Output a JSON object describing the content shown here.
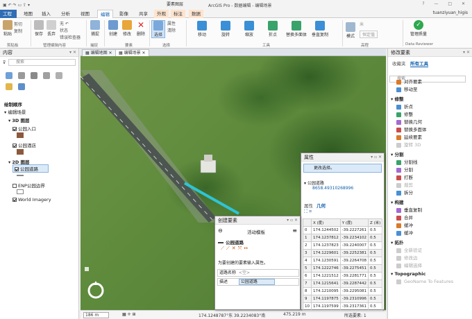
{
  "titlebar": {
    "context_label": "要素图层",
    "title": "ArcGIS Pro - 数据编辑 - 编辑场景",
    "window_controls": "? — □ ✕",
    "user": "tuanziyuan_higis"
  },
  "tabs": [
    "工程",
    "地图",
    "插入",
    "分析",
    "视图",
    "编辑",
    "影像",
    "共享",
    "外观",
    "标注",
    "数据"
  ],
  "ribbon": {
    "clipboard": {
      "paste": "粘贴",
      "cut": "剪切",
      "copy": "复制",
      "group": "剪贴板"
    },
    "manage": {
      "save": "保存",
      "discard": "丢弃",
      "undo": "无 ↶",
      "status": "状态",
      "error_inspector": "错误检查器",
      "group": "管理编辑内容"
    },
    "snapping": {
      "label": "捕捉",
      "group": "捕捉"
    },
    "features": {
      "create": "创建",
      "modify": "修改",
      "delete": "删除",
      "group": "要素"
    },
    "selection": {
      "select": "选择",
      "attributes": "属性",
      "clear": "清除",
      "group": "选择"
    },
    "tools": {
      "items": [
        "移动",
        "旋转",
        "缩放",
        "折点",
        "替换多面体",
        "垂直复制"
      ],
      "group": "工具"
    },
    "elevation": {
      "mode": "模式",
      "value": "恒定值",
      "unit": "米",
      "group": "高程"
    },
    "reviewer": {
      "button": "管理质量",
      "group": "Data Reviewer"
    }
  },
  "view_tabs": [
    "编辑地图",
    "编辑场景"
  ],
  "contents": {
    "title": "内容",
    "search_placeholder": "搜索",
    "drawing_order": "绘制顺序",
    "scene": "编辑场景",
    "layer3d": "3D 图层",
    "park_entrance": "公园入口",
    "park_bldg": "公园酒店",
    "layer2d": "2D 图层",
    "park_road": "公园道路",
    "enp_boundary": "ENP公园边界",
    "imagery": "World Imagery"
  },
  "map": {
    "scale": "186 m",
    "coords": "174.1248787°东 39.2234083°南",
    "elevation": "475.219 m",
    "selected": "所选要素: 1"
  },
  "modify": {
    "title": "修改要素",
    "tab_favorites": "收藏夹",
    "tab_all": "所有工具",
    "search_placeholder": "搜索",
    "sections": [
      {
        "name": "",
        "items": [
          [
            "对齐要素",
            false
          ],
          [
            "移动至",
            false
          ]
        ]
      },
      {
        "name": "修整",
        "items": [
          [
            "折点",
            false
          ],
          [
            "修整",
            false
          ],
          [
            "替换几何",
            false
          ],
          [
            "替换多面体",
            false
          ],
          [
            "延续要素",
            false
          ],
          [
            "旋转 3D",
            true
          ]
        ]
      },
      {
        "name": "分割",
        "items": [
          [
            "分割线",
            false
          ],
          [
            "分割",
            false
          ],
          [
            "打断",
            false
          ],
          [
            "裁剪",
            true
          ],
          [
            "拆分",
            false
          ]
        ]
      },
      {
        "name": "构建",
        "items": [
          [
            "垂直复制",
            false
          ],
          [
            "合并",
            false
          ],
          [
            "缓冲",
            false
          ],
          [
            "缓冲",
            false
          ]
        ]
      },
      {
        "name": "拓扑",
        "items": [
          [
            "全新验证",
            true
          ],
          [
            "修改边",
            true
          ],
          [
            "编辑选择",
            true
          ]
        ]
      },
      {
        "name": "Topographic",
        "items": [
          [
            "GeoName To Features",
            true
          ]
        ]
      }
    ]
  },
  "attributes": {
    "title": "属性",
    "hint": "更改选择。",
    "layer": "公园道路",
    "feature_id": "8658.49310268996",
    "tab_attr": "属性",
    "tab_geom": "几何",
    "columns": [
      "",
      "X (度)",
      "Y (度)",
      "Z (米)"
    ],
    "rows": [
      [
        "0",
        "174.1244502",
        "-39.2227261",
        "0.5"
      ],
      [
        "1",
        "174.1237812",
        "-39.2234102",
        "0.5"
      ],
      [
        "2",
        "174.1237823",
        "-39.2240007",
        "0.5"
      ],
      [
        "3",
        "174.1229601",
        "-39.2252381",
        "0.5"
      ],
      [
        "4",
        "174.1230591",
        "-39.2264708",
        "0.5"
      ],
      [
        "5",
        "174.1222746",
        "-39.2275451",
        "0.5"
      ],
      [
        "6",
        "174.1221512",
        "-39.2281771",
        "0.5"
      ],
      [
        "7",
        "174.1215641",
        "-39.2287442",
        "0.5"
      ],
      [
        "8",
        "174.1210095",
        "-39.2295081",
        "0.5"
      ],
      [
        "9",
        "174.1197875",
        "-39.2310996",
        "0.5"
      ],
      [
        "10",
        "174.1197599",
        "-39.2317361",
        "0.5"
      ]
    ]
  },
  "create": {
    "title": "创建要素",
    "template_label": "活动模板",
    "template_name": "公园道路",
    "message": "为要创建的要素输入属性。",
    "field1_label": "道路名称",
    "field1_value": "<空>",
    "field2_label": "描述",
    "field2_value": "公园道路"
  }
}
